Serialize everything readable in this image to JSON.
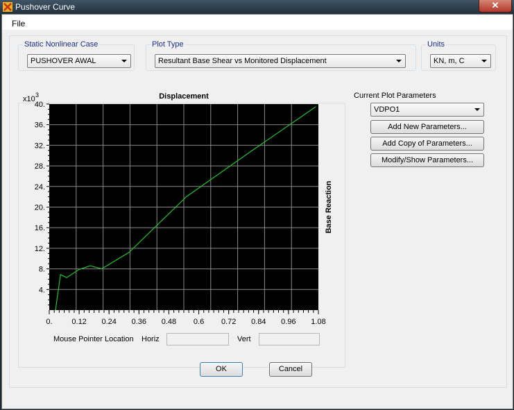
{
  "window": {
    "title": "Pushover Curve",
    "close_label": "✕"
  },
  "menu": {
    "file": "File"
  },
  "static_case": {
    "legend": "Static Nonlinear Case",
    "value": "PUSHOVER AWAL"
  },
  "plot_type": {
    "legend": "Plot Type",
    "value": "Resultant Base Shear vs Monitored Displacement"
  },
  "units": {
    "legend": "Units",
    "value": "KN, m, C"
  },
  "plot_params": {
    "title": "Current Plot Parameters",
    "value": "VDPO1",
    "add_new": "Add New Parameters...",
    "add_copy": "Add Copy of Parameters...",
    "modify": "Modify/Show Parameters..."
  },
  "chart_data": {
    "type": "line",
    "title": "Displacement",
    "ylabel": "Base Reaction",
    "y_multiplier": "x10",
    "y_multiplier_exp": "3",
    "xlim": [
      0.0,
      1.08
    ],
    "ylim": [
      0,
      40
    ],
    "x_ticks": [
      "0.",
      "0.12",
      "0.24",
      "0.36",
      "0.48",
      "0.6",
      "0.72",
      "0.84",
      "0.96",
      "1.08"
    ],
    "y_ticks": [
      "4.",
      "8.",
      "12.",
      "16.",
      "20.",
      "24.",
      "28.",
      "32.",
      "36.",
      "40."
    ],
    "grid": true,
    "background": "#000000",
    "line_color": "#22c32e",
    "series": [
      {
        "x": [
          0.025,
          0.045,
          0.07,
          0.12,
          0.165,
          0.21,
          0.32,
          0.55,
          0.8,
          1.07
        ],
        "y": [
          0.0,
          6.9,
          6.3,
          7.9,
          8.6,
          8.0,
          11.2,
          22.0,
          30.5,
          39.5
        ]
      }
    ]
  },
  "pointer": {
    "label": "Mouse Pointer Location",
    "horiz": "Horiz",
    "vert": "Vert",
    "horiz_value": "",
    "vert_value": ""
  },
  "buttons": {
    "ok": "OK",
    "cancel": "Cancel"
  }
}
